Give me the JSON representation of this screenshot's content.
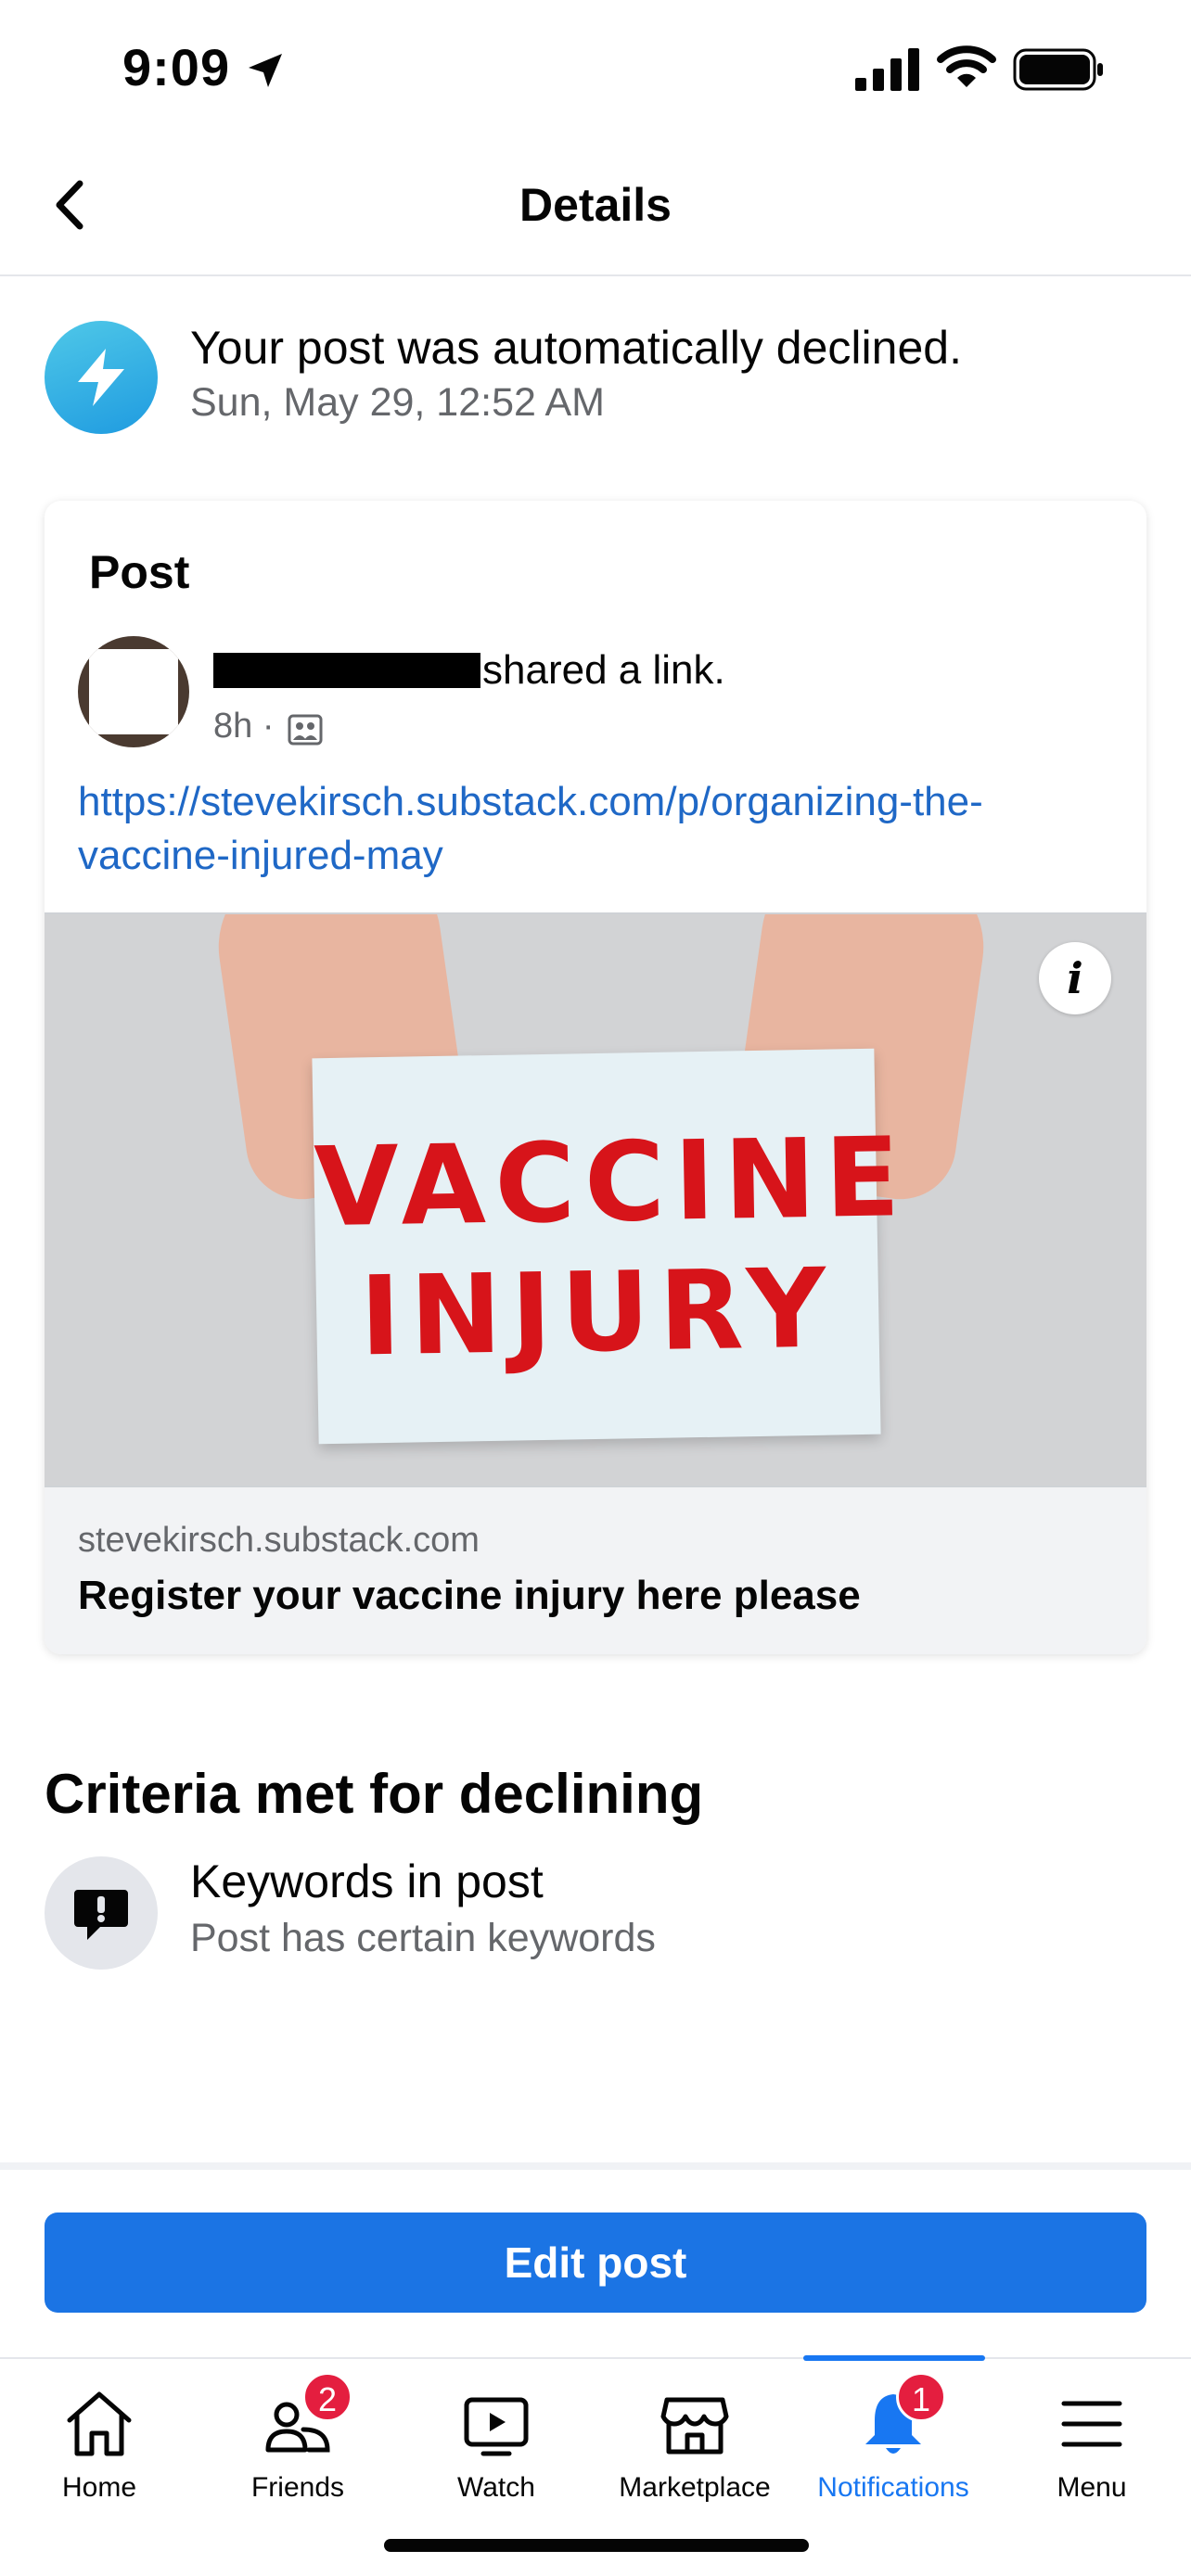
{
  "status_bar": {
    "time": "9:09"
  },
  "header": {
    "title": "Details"
  },
  "notice": {
    "title": "Your post was automatically declined.",
    "timestamp": "Sun, May 29, 12:52 AM"
  },
  "post": {
    "section_label": "Post",
    "author_action": "shared a link.",
    "age": "8h ·",
    "link_url": "https://stevekirsch.substack.com/p/organizing-the-vaccine-injured-may",
    "image_text_line1": "VACCINE",
    "image_text_line2": "INJURY",
    "info_label": "i",
    "link_domain": "stevekirsch.substack.com",
    "link_title": "Register your vaccine injury here please"
  },
  "criteria": {
    "heading": "Criteria met for declining",
    "items": [
      {
        "title": "Keywords in post",
        "description": "Post has certain keywords",
        "icon": "comment-exclamation-icon"
      }
    ]
  },
  "actions": {
    "edit_label": "Edit post"
  },
  "tabbar": {
    "tabs": [
      {
        "label": "Home",
        "icon": "home-icon"
      },
      {
        "label": "Friends",
        "icon": "friends-icon",
        "badge": "2"
      },
      {
        "label": "Watch",
        "icon": "watch-icon"
      },
      {
        "label": "Marketplace",
        "icon": "marketplace-icon"
      },
      {
        "label": "Notifications",
        "icon": "bell-icon",
        "badge": "1",
        "active": true
      },
      {
        "label": "Menu",
        "icon": "menu-icon"
      }
    ]
  },
  "colors": {
    "accent": "#1877f2",
    "button": "#1b74e4",
    "badge": "#e41e3f",
    "link": "#1f68c6"
  }
}
